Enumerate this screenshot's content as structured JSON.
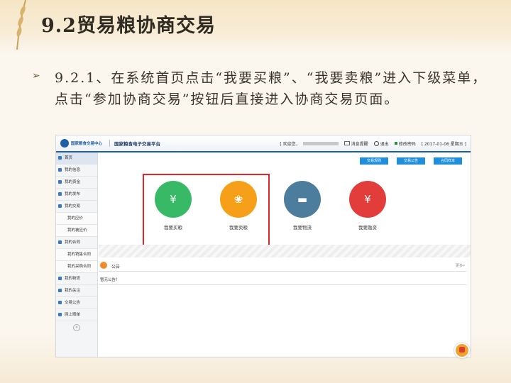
{
  "slide": {
    "title": "9.2贸易粮协商交易",
    "bullet": "9.2.1、在系统首页点击“我要买粮”、“我要卖粮”进入下级菜单，点击“参加协商交易”按钮后直接进入协商交易页面。"
  },
  "header": {
    "org": "国家粮食交易中心",
    "platform": "国家粮食电子交易平台",
    "welcome": "[ 欢迎您，",
    "messages": "消息提醒",
    "logout": "退出",
    "change_password": "修改密码",
    "date": "[ 2017-01-06 星期五 ]"
  },
  "sidebar": {
    "items": [
      {
        "label": "首页",
        "type": "main"
      },
      {
        "label": "我的信息",
        "type": "main"
      },
      {
        "label": "我的资金",
        "type": "main"
      },
      {
        "label": "我的发布",
        "type": "main"
      },
      {
        "label": "我的交易",
        "type": "main"
      },
      {
        "label": "我的应价",
        "type": "sub"
      },
      {
        "label": "我的被应价",
        "type": "sub"
      },
      {
        "label": "我的合同",
        "type": "main"
      },
      {
        "label": "我的销售合同",
        "type": "sub"
      },
      {
        "label": "我的采购合同",
        "type": "sub"
      },
      {
        "label": "我的物流",
        "type": "main"
      },
      {
        "label": "我的关注",
        "type": "main"
      },
      {
        "label": "交易公告",
        "type": "main"
      },
      {
        "label": "网上晒单",
        "type": "main"
      }
    ]
  },
  "toolbar": {
    "rules": "交易规则",
    "announcements": "交易公告",
    "contract": "合同样本"
  },
  "actions": {
    "buy": "我要买粮",
    "sell": "我要卖粮",
    "logistics": "我要物流",
    "finance": "我要融资"
  },
  "notice": {
    "title": "公告",
    "more": "更多»",
    "empty": "暂无公告！"
  },
  "colors": {
    "accent": "#1f5fa8",
    "button": "#1f8fdc",
    "highlight": "#e2262a"
  }
}
